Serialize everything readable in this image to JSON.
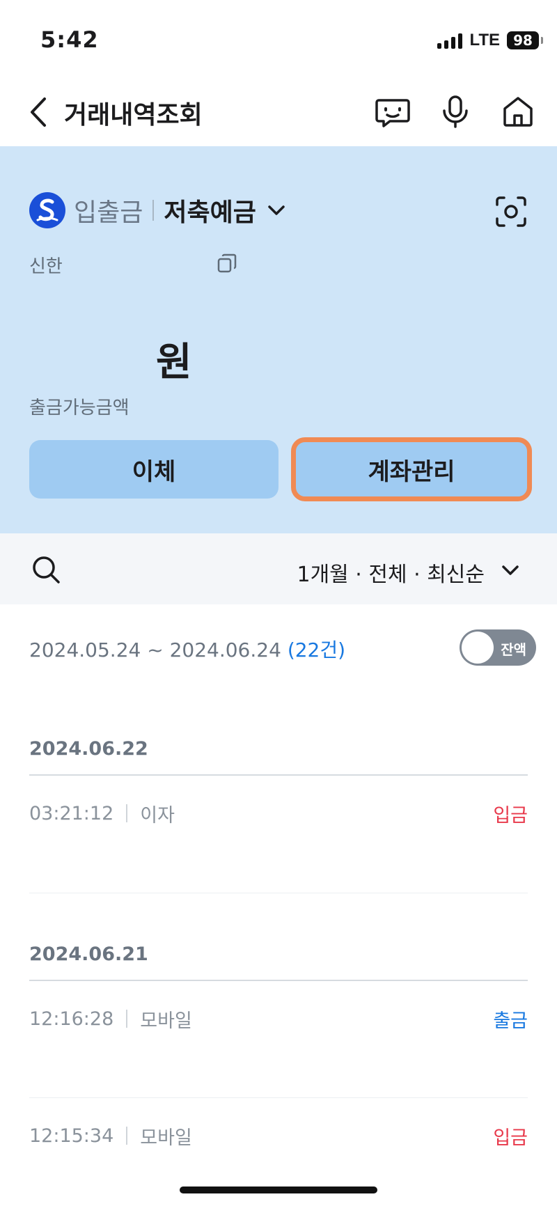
{
  "status_bar": {
    "time": "5:42",
    "network": "LTE",
    "battery": "98"
  },
  "nav": {
    "title": "거래내역조회",
    "icons": [
      "back-icon",
      "chatbot-icon",
      "microphone-icon",
      "home-icon"
    ]
  },
  "account": {
    "type": "입출금",
    "name": "저축예금",
    "bank": "신한",
    "balance_unit": "원",
    "available_label": "출금가능금액",
    "buttons": {
      "transfer": "이체",
      "manage": "계좌관리"
    },
    "colors": {
      "card_bg": "#cfe5f8",
      "button_bg": "#9fcbf2",
      "highlight": "#f08a54",
      "logo": "#1a4fd8"
    }
  },
  "filter": {
    "label": "1개월 · 전체 · 최신순"
  },
  "period": {
    "range": "2024.05.24 ~ 2024.06.24",
    "count": "(22건)",
    "toggle_label": "잔액",
    "toggle_on": false
  },
  "groups": [
    {
      "date": "2024.06.22",
      "items": [
        {
          "time": "03:21:12",
          "desc": "이자",
          "kind": "입금",
          "direction": "in"
        }
      ]
    },
    {
      "date": "2024.06.21",
      "items": [
        {
          "time": "12:16:28",
          "desc": "모바일",
          "kind": "출금",
          "direction": "out"
        },
        {
          "time": "12:15:34",
          "desc": "모바일",
          "kind": "입금",
          "direction": "in"
        }
      ]
    }
  ]
}
